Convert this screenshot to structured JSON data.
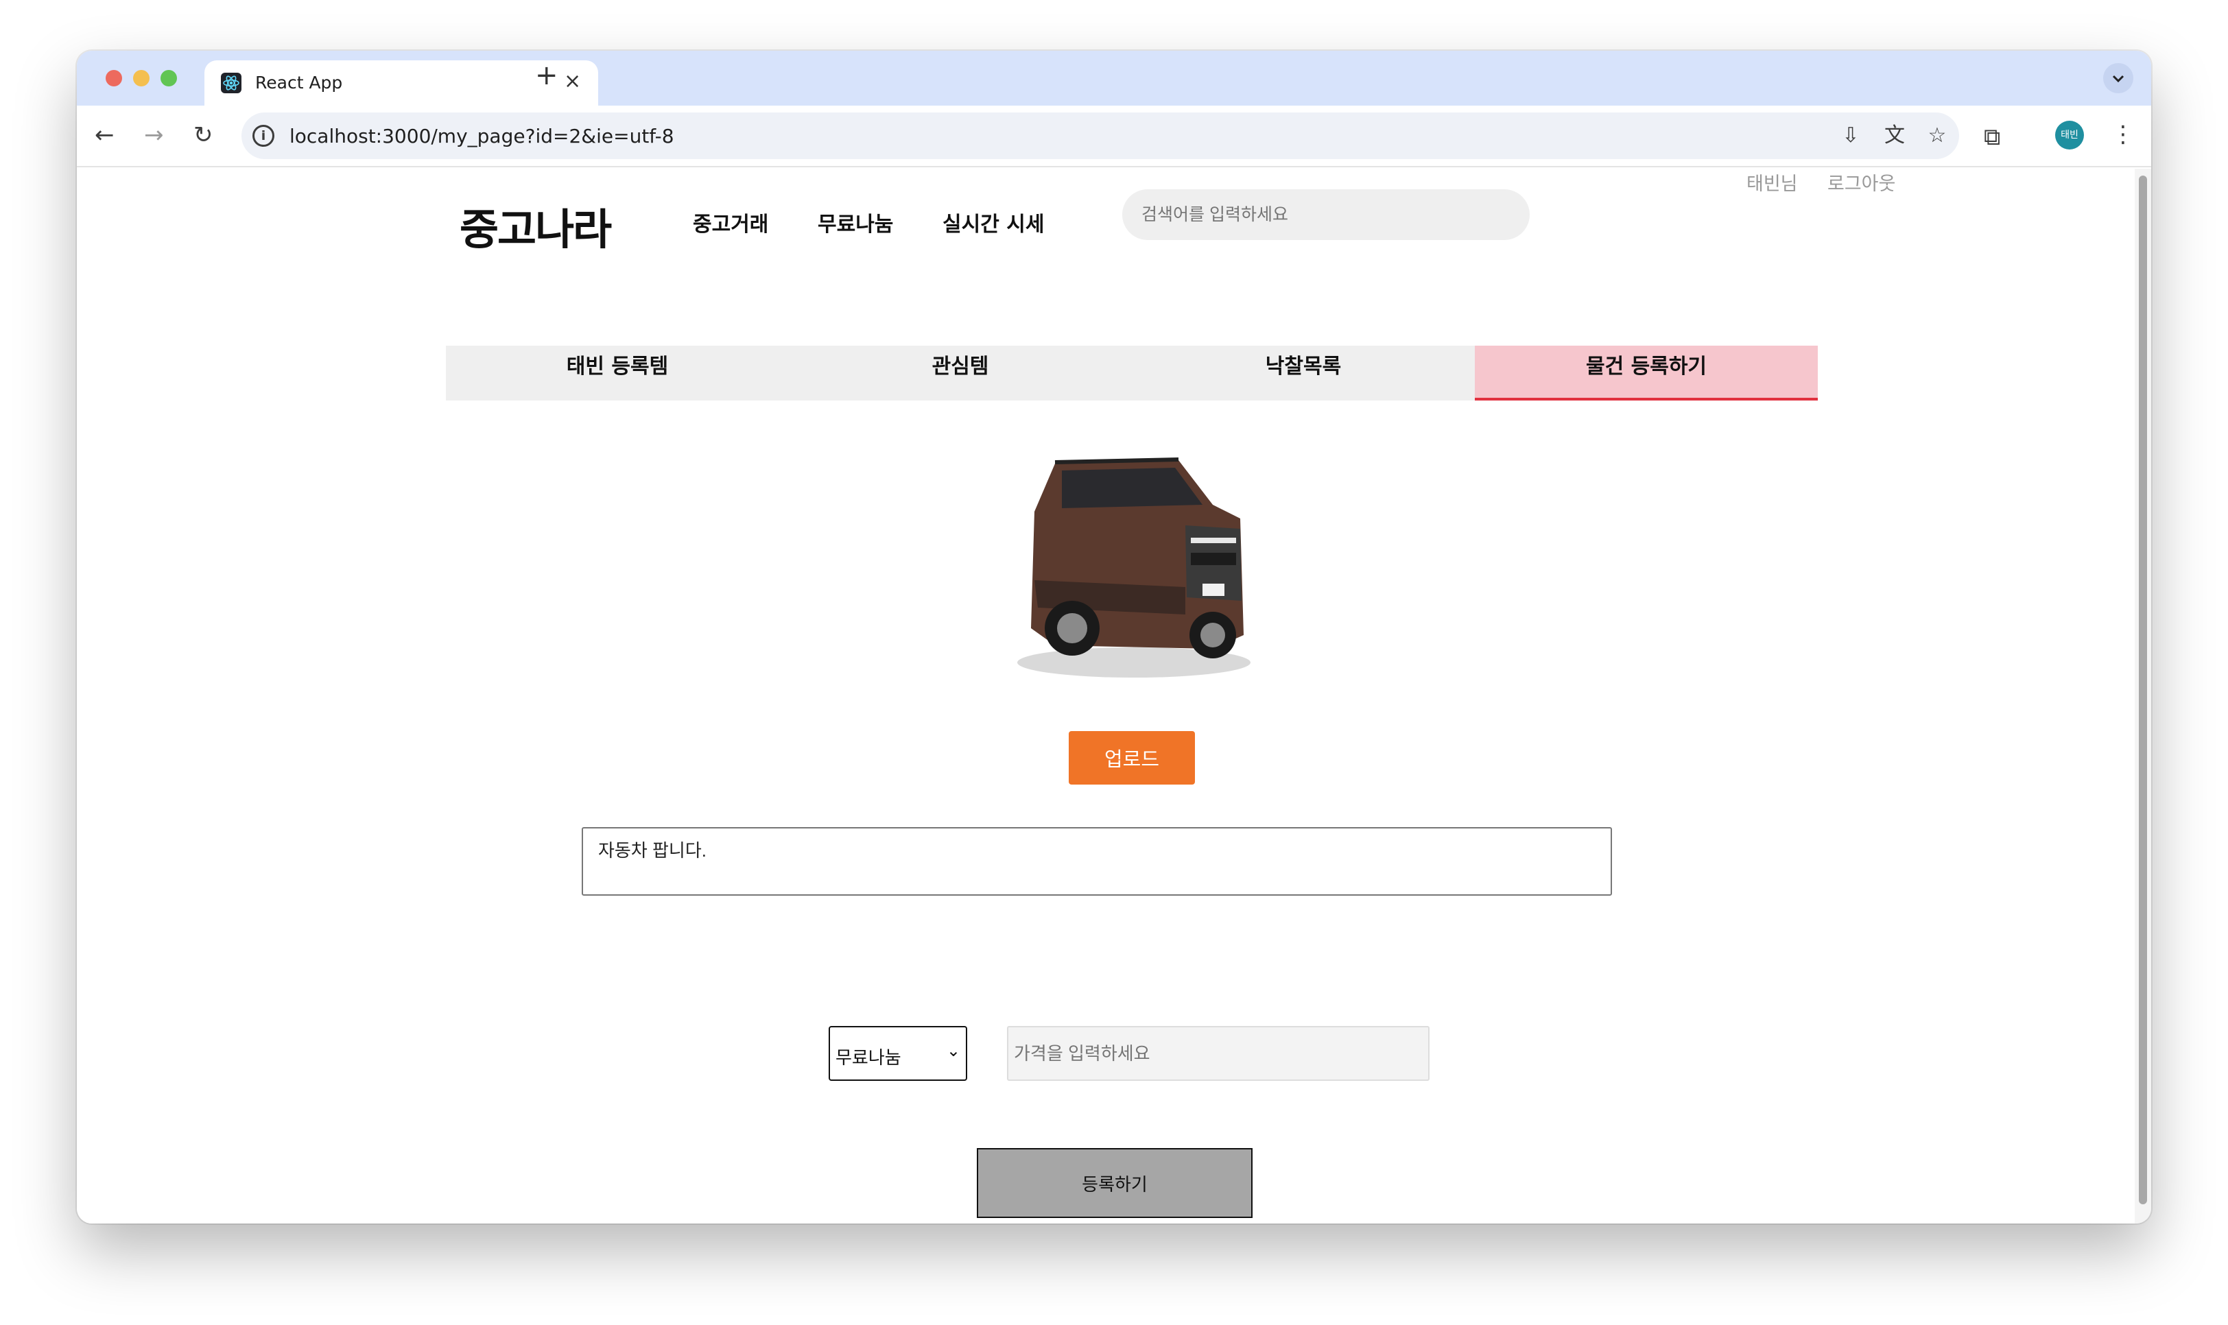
{
  "browser": {
    "tab_title": "React App",
    "url": "localhost:3000/my_page?id=2&ie=utf-8",
    "profile_initials": "태빈"
  },
  "header": {
    "logo": "중고나라",
    "nav": [
      "중고거래",
      "무료나눔",
      "실시간 시세"
    ],
    "search_placeholder": "검색어를 입력하세요",
    "user_name": "태빈님",
    "logout": "로그아웃"
  },
  "my_tabs": {
    "items": [
      "태빈 등록템",
      "관심템",
      "낙찰목록",
      "물건 등록하기"
    ],
    "active_index": 3
  },
  "form": {
    "upload_label": "업로드",
    "description_value": "자동차 팝니다.",
    "trade_type_selected": "무료나눔",
    "price_placeholder": "가격을 입력하세요",
    "submit_label": "등록하기"
  },
  "colors": {
    "accent_orange": "#f07427",
    "active_tab_bg": "#f6c6cd",
    "active_tab_border": "#e1313f"
  }
}
